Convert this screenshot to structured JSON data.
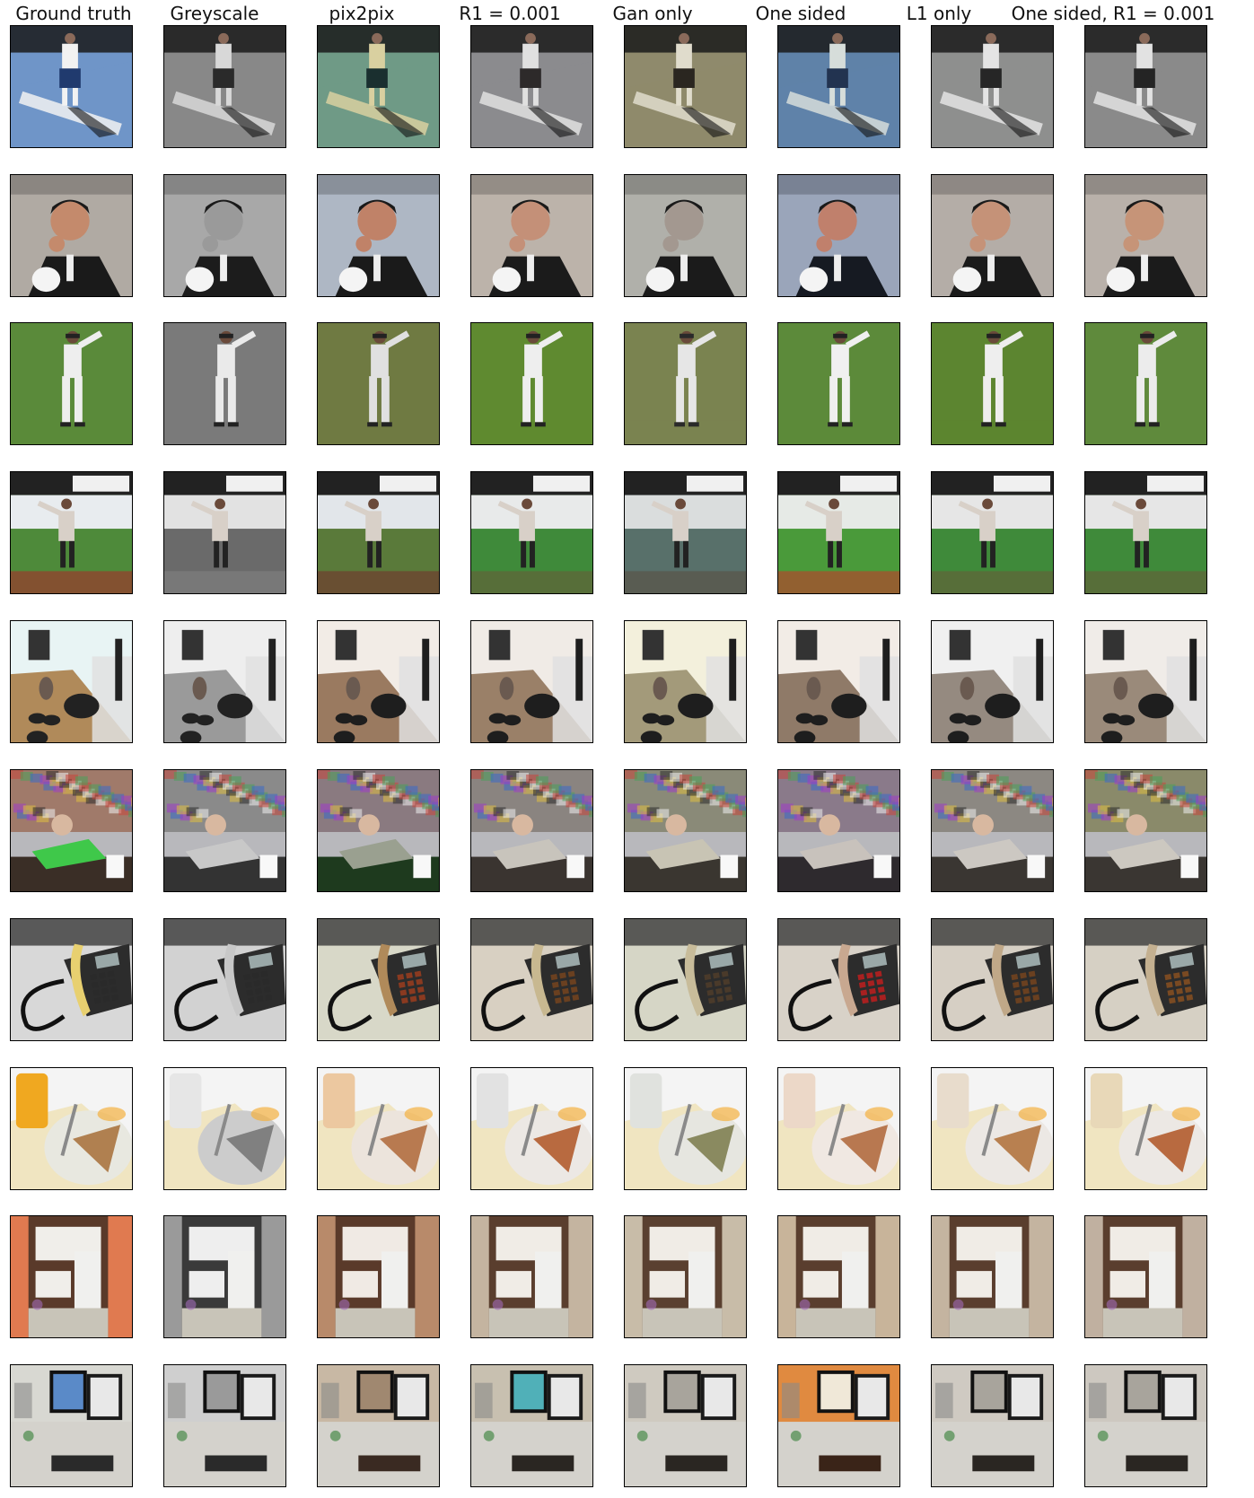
{
  "columns": [
    "Ground truth",
    "Greyscale",
    "pix2pix",
    "R1 = 0.001",
    "Gan only",
    "One sided",
    "L1 only",
    "One sided, R1 = 0.001"
  ],
  "rows": [
    {
      "scene": "tennis-player",
      "ground_truth": [
        "#6f95c8",
        "#f2f2f2",
        "#203a6e"
      ],
      "results": [
        [
          "#888888",
          "#d8d8d8",
          "#2a2a2a"
        ],
        [
          "#6f9a86",
          "#d9d0a0",
          "#1a2f2f"
        ],
        [
          "#8b8b8e",
          "#e0e0e0",
          "#2d2a2a"
        ],
        [
          "#8f8a6c",
          "#e0dccc",
          "#2a2620"
        ],
        [
          "#5f82a8",
          "#d6ddda",
          "#223350"
        ],
        [
          "#8e8f8e",
          "#e4e4e4",
          "#262626"
        ],
        [
          "#8a8a8a",
          "#e2e2e2",
          "#242424"
        ]
      ]
    },
    {
      "scene": "man-eating",
      "ground_truth": [
        "#b0aaa3",
        "#c48a6c",
        "#1a1a1a"
      ],
      "results": [
        [
          "#a8a8a8",
          "#9a9a9a",
          "#1c1c1c"
        ],
        [
          "#aeb7c4",
          "#c08268",
          "#1a1a1a"
        ],
        [
          "#bcb3aa",
          "#c49078",
          "#1b1b1b"
        ],
        [
          "#b0b0aa",
          "#a39890",
          "#1b1b1b"
        ],
        [
          "#9aa5ba",
          "#c0806c",
          "#161a22"
        ],
        [
          "#b4ada7",
          "#c59278",
          "#1b1b1b"
        ],
        [
          "#b9b1aa",
          "#c69478",
          "#1b1b1b"
        ]
      ]
    },
    {
      "scene": "baseball-pitcher",
      "ground_truth": [
        "#5a8a3a",
        "#eeeeee",
        "#222222"
      ],
      "results": [
        [
          "#7a7a7a",
          "#eaeaea",
          "#222222"
        ],
        [
          "#6f7a42",
          "#e0e0e0",
          "#222222"
        ],
        [
          "#5f8a30",
          "#eeeeee",
          "#222222"
        ],
        [
          "#7a8350",
          "#e6e6e6",
          "#2a2a2a"
        ],
        [
          "#5c8a3a",
          "#f0f0f0",
          "#222222"
        ],
        [
          "#5c8530",
          "#eeeeee",
          "#222222"
        ],
        [
          "#5f8a3c",
          "#ececec",
          "#222222"
        ]
      ]
    },
    {
      "scene": "stadium-pitcher",
      "ground_truth": [
        "#4e8a3a",
        "#e8ecef",
        "#8a4a30"
      ],
      "results": [
        [
          "#6a6a6a",
          "#e2e2e2",
          "#7a7a7a"
        ],
        [
          "#5a7a3a",
          "#e2e6ea",
          "#6a4a32"
        ],
        [
          "#3f8a3a",
          "#e8eaea",
          "#5a6a3a"
        ],
        [
          "#58706a",
          "#dadddd",
          "#5a5a50"
        ],
        [
          "#4a9a3a",
          "#e6eae6",
          "#9a5a30"
        ],
        [
          "#3f8a3a",
          "#e6e6e6",
          "#5a6a3a"
        ],
        [
          "#3f8a3a",
          "#e6e6e6",
          "#5a6a3a"
        ]
      ]
    },
    {
      "scene": "room-with-cat",
      "ground_truth": [
        "#b08a5a",
        "#e8f4f4",
        "#222222"
      ],
      "results": [
        [
          "#9a9a9a",
          "#eeeeee",
          "#222222"
        ],
        [
          "#9a7a60",
          "#f2ece6",
          "#1e1e1e"
        ],
        [
          "#9a8068",
          "#f0ebe6",
          "#1e1e1e"
        ],
        [
          "#a39a7a",
          "#f3f0dc",
          "#1e1e1e"
        ],
        [
          "#8f7a68",
          "#f2ece6",
          "#1e1e1e"
        ],
        [
          "#958a80",
          "#f0f0f0",
          "#1e1e1e"
        ],
        [
          "#9a8a7a",
          "#f0ece8",
          "#1e1e1e"
        ]
      ]
    },
    {
      "scene": "young-man-couch",
      "ground_truth": [
        "#a07a6a",
        "#3fc84a",
        "#3a2e26"
      ],
      "results": [
        [
          "#8a8a8a",
          "#c8c8c8",
          "#333333"
        ],
        [
          "#8a7a80",
          "#9aa090",
          "#1e3a1e"
        ],
        [
          "#8a8480",
          "#c8c4bc",
          "#3a3430"
        ],
        [
          "#8a8a78",
          "#c8c4b4",
          "#3a3630"
        ],
        [
          "#8a7a8a",
          "#c8c2bc",
          "#2e2a2e"
        ],
        [
          "#8c8882",
          "#ccc8c2",
          "#3a3632"
        ],
        [
          "#8a8a6a",
          "#ccc8c0",
          "#3a3632"
        ]
      ]
    },
    {
      "scene": "desk-telephone",
      "ground_truth": [
        "#d8d8d8",
        "#e8d070",
        "#2a2a2a"
      ],
      "results": [
        [
          "#d2d2d2",
          "#c8c8c8",
          "#2a2a2a"
        ],
        [
          "#d8d8c8",
          "#b08a5a",
          "#8a3a20"
        ],
        [
          "#d8d0c2",
          "#c8b890",
          "#6a4020"
        ],
        [
          "#d6d6c6",
          "#c8bc9a",
          "#4a3a2a"
        ],
        [
          "#d8d2c8",
          "#c8a890",
          "#a82020"
        ],
        [
          "#d6cfc4",
          "#c0a888",
          "#6a4020"
        ],
        [
          "#d6d0c4",
          "#c4b090",
          "#7a4a22"
        ]
      ]
    },
    {
      "scene": "juice-and-pie",
      "ground_truth": [
        "#f0a820",
        "#e8e8e0",
        "#b08050"
      ],
      "results": [
        [
          "#e6e6e6",
          "#cccccc",
          "#808080"
        ],
        [
          "#ecc8a0",
          "#ece4dc",
          "#b87a50"
        ],
        [
          "#e2e2e2",
          "#ece8e4",
          "#b86a40"
        ],
        [
          "#e0e2de",
          "#e6e6e0",
          "#8a8a60"
        ],
        [
          "#ecd8c8",
          "#f0e8e2",
          "#b87850"
        ],
        [
          "#e8dccc",
          "#ece8e4",
          "#b88050"
        ],
        [
          "#e8d8b8",
          "#ece8e4",
          "#b86a40"
        ]
      ]
    },
    {
      "scene": "kitchen",
      "ground_truth": [
        "#e07a50",
        "#5a3a2a",
        "#f0eeea"
      ],
      "results": [
        [
          "#9a9a9a",
          "#3a3a3a",
          "#eeeeee"
        ],
        [
          "#b88a6a",
          "#5a3a2a",
          "#f0eae4"
        ],
        [
          "#c4b4a0",
          "#5a3e2e",
          "#f0ece6"
        ],
        [
          "#c8bca8",
          "#5a4030",
          "#f0ece6"
        ],
        [
          "#c8b49a",
          "#5a3e2e",
          "#f0ece6"
        ],
        [
          "#c4b4a0",
          "#5a3e2e",
          "#f0ece6"
        ],
        [
          "#c0b0a0",
          "#5a3e2e",
          "#f0ece6"
        ]
      ]
    },
    {
      "scene": "computer-desk",
      "ground_truth": [
        "#d8d8d2",
        "#5a8ac8",
        "#2a2a2a"
      ],
      "results": [
        [
          "#cfcfcf",
          "#9a9a9a",
          "#2a2a2a"
        ],
        [
          "#c8b8a4",
          "#a08870",
          "#3a2a22"
        ],
        [
          "#c8c0b0",
          "#50b0b8",
          "#2a2622"
        ],
        [
          "#cfcac0",
          "#a8a49c",
          "#2a2622"
        ],
        [
          "#e08a40",
          "#f0e8d8",
          "#3a2418"
        ],
        [
          "#cfcac2",
          "#a8a49c",
          "#2a2622"
        ],
        [
          "#cdc8c0",
          "#a8a49c",
          "#2a2622"
        ]
      ]
    }
  ]
}
